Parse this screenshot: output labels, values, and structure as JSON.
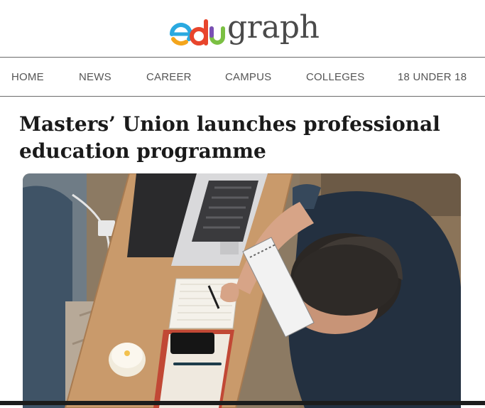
{
  "site": {
    "logo": {
      "prefix": "edu",
      "suffix": "graph"
    }
  },
  "nav": {
    "items": [
      {
        "label": "HOME"
      },
      {
        "label": "NEWS"
      },
      {
        "label": "CAREER"
      },
      {
        "label": "CAMPUS"
      },
      {
        "label": "COLLEGES"
      },
      {
        "label": "18 UNDER 18"
      }
    ]
  },
  "article": {
    "headline": "Masters’ Union launches professional education programme",
    "hero_image": {
      "subject": "person-writing-at-desk-with-laptop"
    }
  },
  "colors": {
    "logo_graph": "#4a4a4a",
    "logo_e": "#2aa9e0",
    "logo_d": "#e8452c",
    "logo_u": "#7bc043",
    "nav_text": "#555555",
    "headline": "#1a1a1a"
  }
}
